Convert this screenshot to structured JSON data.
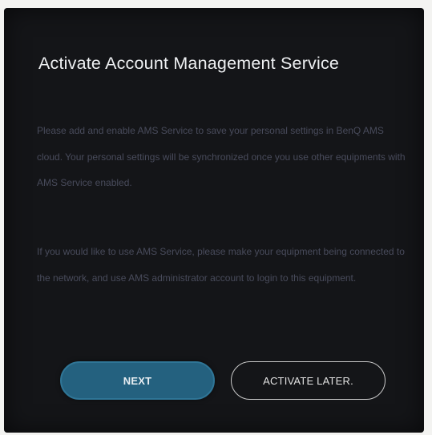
{
  "dialog": {
    "title": "Activate Account Management Service",
    "paragraphs": [
      "Please add and enable AMS Service to save your personal settings in BenQ AMS cloud. Your personal settings will be synchronized once you use other equipments with AMS Service enabled.",
      "If you would like to use AMS Service, please make your equipment being connected to the network, and use AMS administrator account to login to this equipment."
    ],
    "buttons": {
      "next_label": "NEXT",
      "later_label": "ACTIVATE LATER."
    }
  },
  "colors": {
    "dialog_background": "#141518",
    "next_button": "#24617f",
    "body_text": "#5a5d72"
  }
}
